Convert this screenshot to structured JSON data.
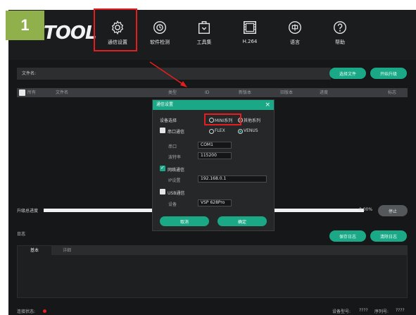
{
  "step_badge": "1",
  "brand": "TOOL",
  "nav": [
    {
      "label": "通信设置",
      "icon": "gear-icon"
    },
    {
      "label": "软件检测",
      "icon": "scan-icon"
    },
    {
      "label": "工具集",
      "icon": "toolbox-icon"
    },
    {
      "label": "H.264",
      "icon": "film-icon"
    },
    {
      "label": "语言",
      "icon": "language-icon"
    },
    {
      "label": "帮助",
      "icon": "help-icon"
    }
  ],
  "file_row": {
    "label": "文件名:"
  },
  "buttons": {
    "select_file": "选择文件",
    "start_upgrade": "开始升级",
    "save_log": "保存日志",
    "clear_log": "清除日志",
    "stop": "停止"
  },
  "grid_columns": [
    "所有",
    "文件名",
    "类型",
    "ID",
    "新版本",
    "旧版本",
    "进度",
    "标志"
  ],
  "progress": {
    "label": "升级总进度",
    "value_text": "0.00%",
    "fraction": 0.0
  },
  "log": {
    "label": "日志",
    "tabs": [
      "基本",
      "详细"
    ]
  },
  "status": {
    "conn_label": "连接状态:",
    "device_model_label": "设备型号:",
    "device_model_value": "????",
    "serial_label": "序列号:",
    "serial_value": "????"
  },
  "dialog": {
    "title": "通信设置",
    "device_select_label": "设备选择",
    "device_options": [
      "MINI系列",
      "其他系列"
    ],
    "serial_comm": "串口通信",
    "serial_modes": [
      "FLEX",
      "VENUS"
    ],
    "port_label": "串口",
    "port_value": "COM1",
    "baud_label": "波特率",
    "baud_value": "115200",
    "network_comm": "网络通信",
    "ip_label": "IP设置",
    "ip_value": "192.168.0.1",
    "usb_comm": "USB通信",
    "device_label": "设备",
    "device_value": "VSP 628Pro",
    "cancel": "取消",
    "ok": "确定"
  },
  "colors": {
    "accent": "#1aa886",
    "highlight": "#e41e1e",
    "badge": "#8fb04a",
    "status_dot": "#e41e1e"
  }
}
